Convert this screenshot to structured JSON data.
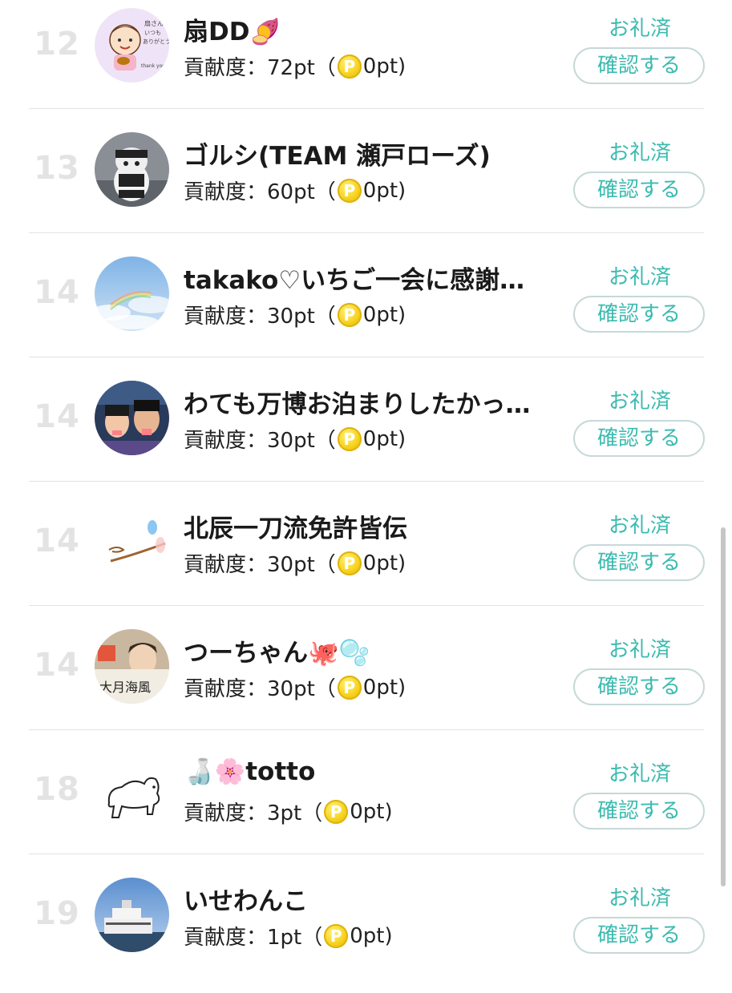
{
  "rows": [
    {
      "rank": "12",
      "name": "扇DD🍠",
      "contrib": "貢献度：72pt（",
      "points": "0pt)",
      "coin_symbol": "P",
      "thanks": "お礼済",
      "confirm": "確認する",
      "avatar": "avatar-hand-drawn-character"
    },
    {
      "rank": "13",
      "name": "ゴルシ(TEAM 瀬戸ローズ)",
      "contrib": "貢献度：60pt（",
      "points": "0pt)",
      "coin_symbol": "P",
      "thanks": "お礼済",
      "confirm": "確認する",
      "avatar": "avatar-horse-plush"
    },
    {
      "rank": "14",
      "name": "takako♡いちご一会に感謝…",
      "contrib": "貢献度：30pt（",
      "points": "0pt)",
      "coin_symbol": "P",
      "thanks": "お礼済",
      "confirm": "確認する",
      "avatar": "avatar-sky-rainbow"
    },
    {
      "rank": "14",
      "name": "わても万博お泊まりしたかっ…",
      "contrib": "貢献度：30pt（",
      "points": "0pt)",
      "coin_symbol": "P",
      "thanks": "お礼済",
      "confirm": "確認する",
      "avatar": "avatar-actors-photo"
    },
    {
      "rank": "14",
      "name": "北辰一刀流免許皆伝",
      "contrib": "貢献度：30pt（",
      "points": "0pt)",
      "coin_symbol": "P",
      "thanks": "お礼済",
      "confirm": "確認する",
      "avatar": "avatar-sketch"
    },
    {
      "rank": "14",
      "name": "つーちゃん🐙🫧",
      "contrib": "貢献度：30pt（",
      "points": "0pt)",
      "coin_symbol": "P",
      "thanks": "お礼済",
      "confirm": "確認する",
      "avatar": "avatar-person-calligraphy"
    },
    {
      "rank": "18",
      "name": "🍶🌸totto",
      "contrib": "貢献度：3pt（",
      "points": "0pt)",
      "coin_symbol": "P",
      "thanks": "お礼済",
      "confirm": "確認する",
      "avatar": "avatar-bear-drawing"
    },
    {
      "rank": "19",
      "name": "いせわんこ",
      "contrib": "貢献度：1pt（",
      "points": "0pt)",
      "coin_symbol": "P",
      "thanks": "お礼済",
      "confirm": "確認する",
      "avatar": "avatar-ship-photo"
    }
  ],
  "colors": {
    "accent": "#3bbbb0",
    "rank": "#e3e3e3",
    "divider": "#e2e2e2",
    "button_border": "#c7d8d8",
    "coin": "#f6d21b"
  }
}
